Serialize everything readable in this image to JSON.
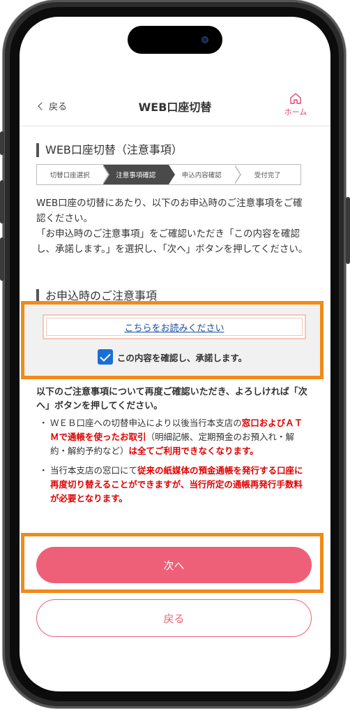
{
  "header": {
    "back_label": "戻る",
    "title": "WEB口座切替",
    "home_label": "ホーム"
  },
  "section1": {
    "heading": "WEB口座切替（注意事項）"
  },
  "steps": [
    {
      "label": "切替口座選択",
      "active": false
    },
    {
      "label": "注意事項確認",
      "active": true
    },
    {
      "label": "申込内容確認",
      "active": false
    },
    {
      "label": "受付完了",
      "active": false
    }
  ],
  "intro": {
    "p1": "WEB口座の切替にあたり、以下のお申込時のご注意事項をご確認ください。",
    "p2": "「お申込時のご注意事項」をご確認いただき「この内容を確認し、承諾します。」を選択し、「次へ」ボタンを押してください。"
  },
  "section2": {
    "heading": "お申込時のご注意事項"
  },
  "agreement": {
    "read_link": "こちらをお読みください",
    "confirm_label": "この内容を確認し、承諾します。",
    "checked": true
  },
  "notice": "以下のご注意事項について再度ご確認いただき、よろしければ「次へ」ボタンを押してください。",
  "bullets": {
    "b1_a": "ＷＥＢ口座への切替申込により以後当行本支店の",
    "b1_b": "窓口およびＡＴＭで通帳を使ったお取引",
    "b1_c": "（明細記帳、定期預金のお預入れ・解約・解約予約など）",
    "b1_d": "は全てご利用できなくなります。",
    "b2_a": "当行本支店の窓口にて",
    "b2_b": "従来の紙媒体の預金通帳を発行する口座に再度切り替えることができますが、当行所定の通帳再発行手数料が必要となります。",
    "marker": "・"
  },
  "buttons": {
    "next": "次へ",
    "back": "戻る"
  },
  "colors": {
    "accent": "#ee6078",
    "highlight": "#f28a17",
    "warning": "#e00000",
    "link": "#1a4fa0"
  }
}
